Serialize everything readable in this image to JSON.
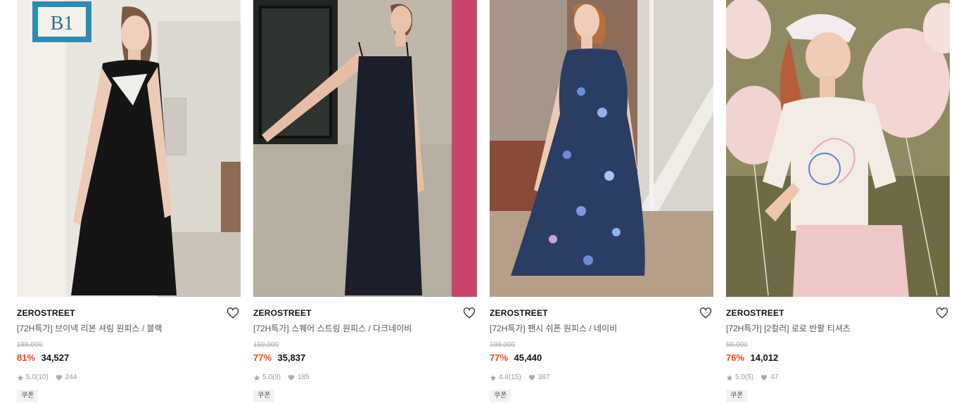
{
  "products": [
    {
      "brand": "ZEROSTREET",
      "name": "[72H특가] 브이넥 리본 셔링 원피스 / 블랙",
      "original_price": "189,000",
      "discount": "81%",
      "price": "34,527",
      "rating": "5.0",
      "reviews": "(10)",
      "likes": "244",
      "badge": "쿠폰",
      "sign_text": "B1",
      "colors": {
        "bg": "#dcd7ce",
        "garment": "#141414",
        "wall": "#efece6"
      }
    },
    {
      "brand": "ZEROSTREET",
      "name": "[72H특가] 스퀘어 스트링 원피스 / 다크네이비",
      "original_price": "159,000",
      "discount": "77%",
      "price": "35,837",
      "rating": "5.0",
      "reviews": "(3)",
      "likes": "185",
      "badge": "쿠폰",
      "colors": {
        "bg": "#c9c2b6",
        "garment": "#1a1f2b",
        "accent": "#c7466a"
      }
    },
    {
      "brand": "ZEROSTREET",
      "name": "[72H특가] 팬시 쉬폰 원피스 / 네이비",
      "original_price": "199,000",
      "discount": "77%",
      "price": "45,440",
      "rating": "4.8",
      "reviews": "(15)",
      "likes": "387",
      "badge": "쿠폰",
      "colors": {
        "bg": "#8c6c5a",
        "garment": "#2b3d63",
        "accent": "#e8e6e0"
      }
    },
    {
      "brand": "ZEROSTREET",
      "name": "[72H특가] [2컬러] 로로 반팔 티셔츠",
      "original_price": "59,000",
      "discount": "76%",
      "price": "14,012",
      "rating": "5.0",
      "reviews": "(5)",
      "likes": "47",
      "badge": "쿠폰",
      "colors": {
        "bg": "#8f8a62",
        "garment": "#f3ece4",
        "accent": "#efcfcf"
      }
    }
  ],
  "icons": {
    "like": "heart-outline-icon",
    "star": "star-icon",
    "likes": "heart-filled-icon"
  },
  "accent_colors": {
    "discount": "#ee4b1a",
    "brand_text": "#111111"
  }
}
